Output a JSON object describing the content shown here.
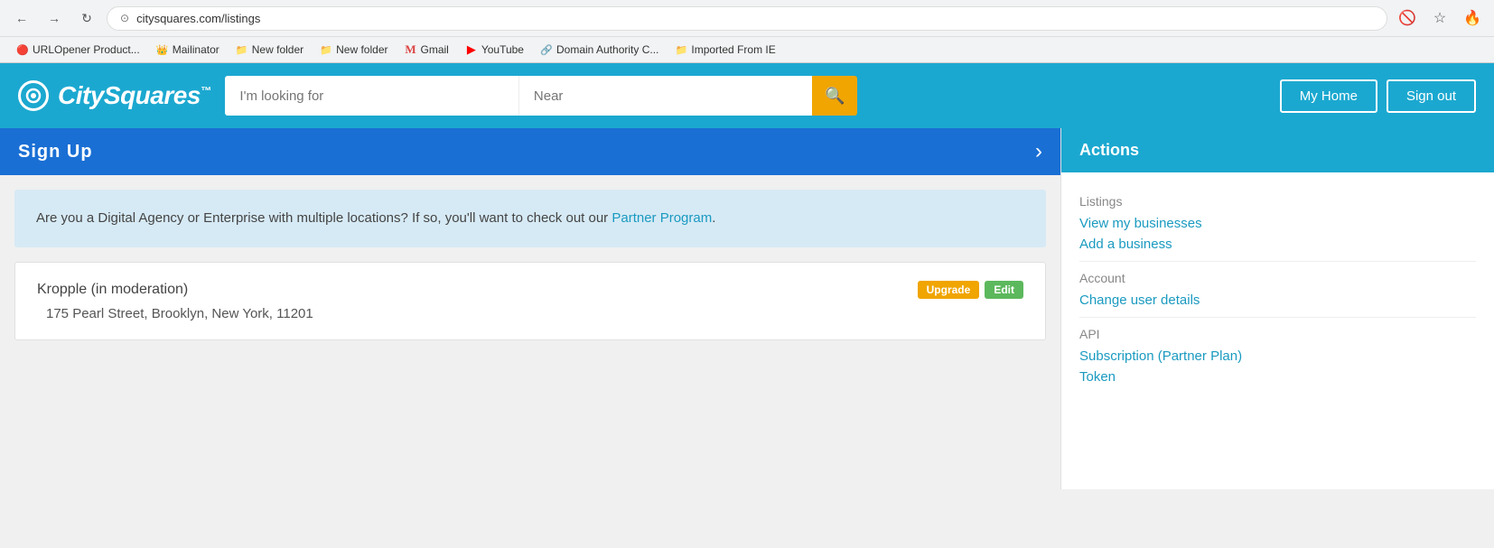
{
  "browser": {
    "url": "citysquares.com/listings",
    "nav": {
      "back_label": "←",
      "forward_label": "→",
      "refresh_label": "↻"
    },
    "icons": {
      "eye_slash": "🚫",
      "star": "☆",
      "fire": "🔥"
    },
    "bookmarks": [
      {
        "id": "urlopener",
        "label": "URLOpener Product...",
        "icon": "🔴"
      },
      {
        "id": "mailinator",
        "label": "Mailinator",
        "icon": "👑"
      },
      {
        "id": "new-folder-1",
        "label": "New folder",
        "icon": "📁"
      },
      {
        "id": "new-folder-2",
        "label": "New folder",
        "icon": "📁"
      },
      {
        "id": "gmail",
        "label": "Gmail",
        "icon": "M"
      },
      {
        "id": "youtube",
        "label": "YouTube",
        "icon": "▶"
      },
      {
        "id": "domain-authority",
        "label": "Domain Authority C...",
        "icon": "🔗"
      },
      {
        "id": "imported-from-ie",
        "label": "Imported From IE",
        "icon": "📁"
      }
    ]
  },
  "header": {
    "logo_text": "CitySquares",
    "logo_tm": "™",
    "search_placeholder": "I'm looking for",
    "near_placeholder": "Near",
    "search_icon": "🔍",
    "my_home_label": "My Home",
    "sign_out_label": "Sign out"
  },
  "signup_banner": {
    "text": "Sign Up",
    "arrow": "›"
  },
  "partner_box": {
    "text_before": "Are you a Digital Agency or Enterprise with multiple locations? If so, you'll want to check out our",
    "link_text": "Partner Program",
    "text_after": "."
  },
  "business_card": {
    "name": "Kropple (in moderation)",
    "address": "175 Pearl Street, Brooklyn, New York, 11201",
    "upgrade_label": "Upgrade",
    "edit_label": "Edit"
  },
  "sidebar": {
    "header": "Actions",
    "listings_label": "Listings",
    "view_businesses_link": "View my businesses",
    "add_business_link": "Add a business",
    "account_label": "Account",
    "change_user_link": "Change user details",
    "api_label": "API",
    "subscription_link": "Subscription (Partner Plan)",
    "token_link": "Token"
  }
}
